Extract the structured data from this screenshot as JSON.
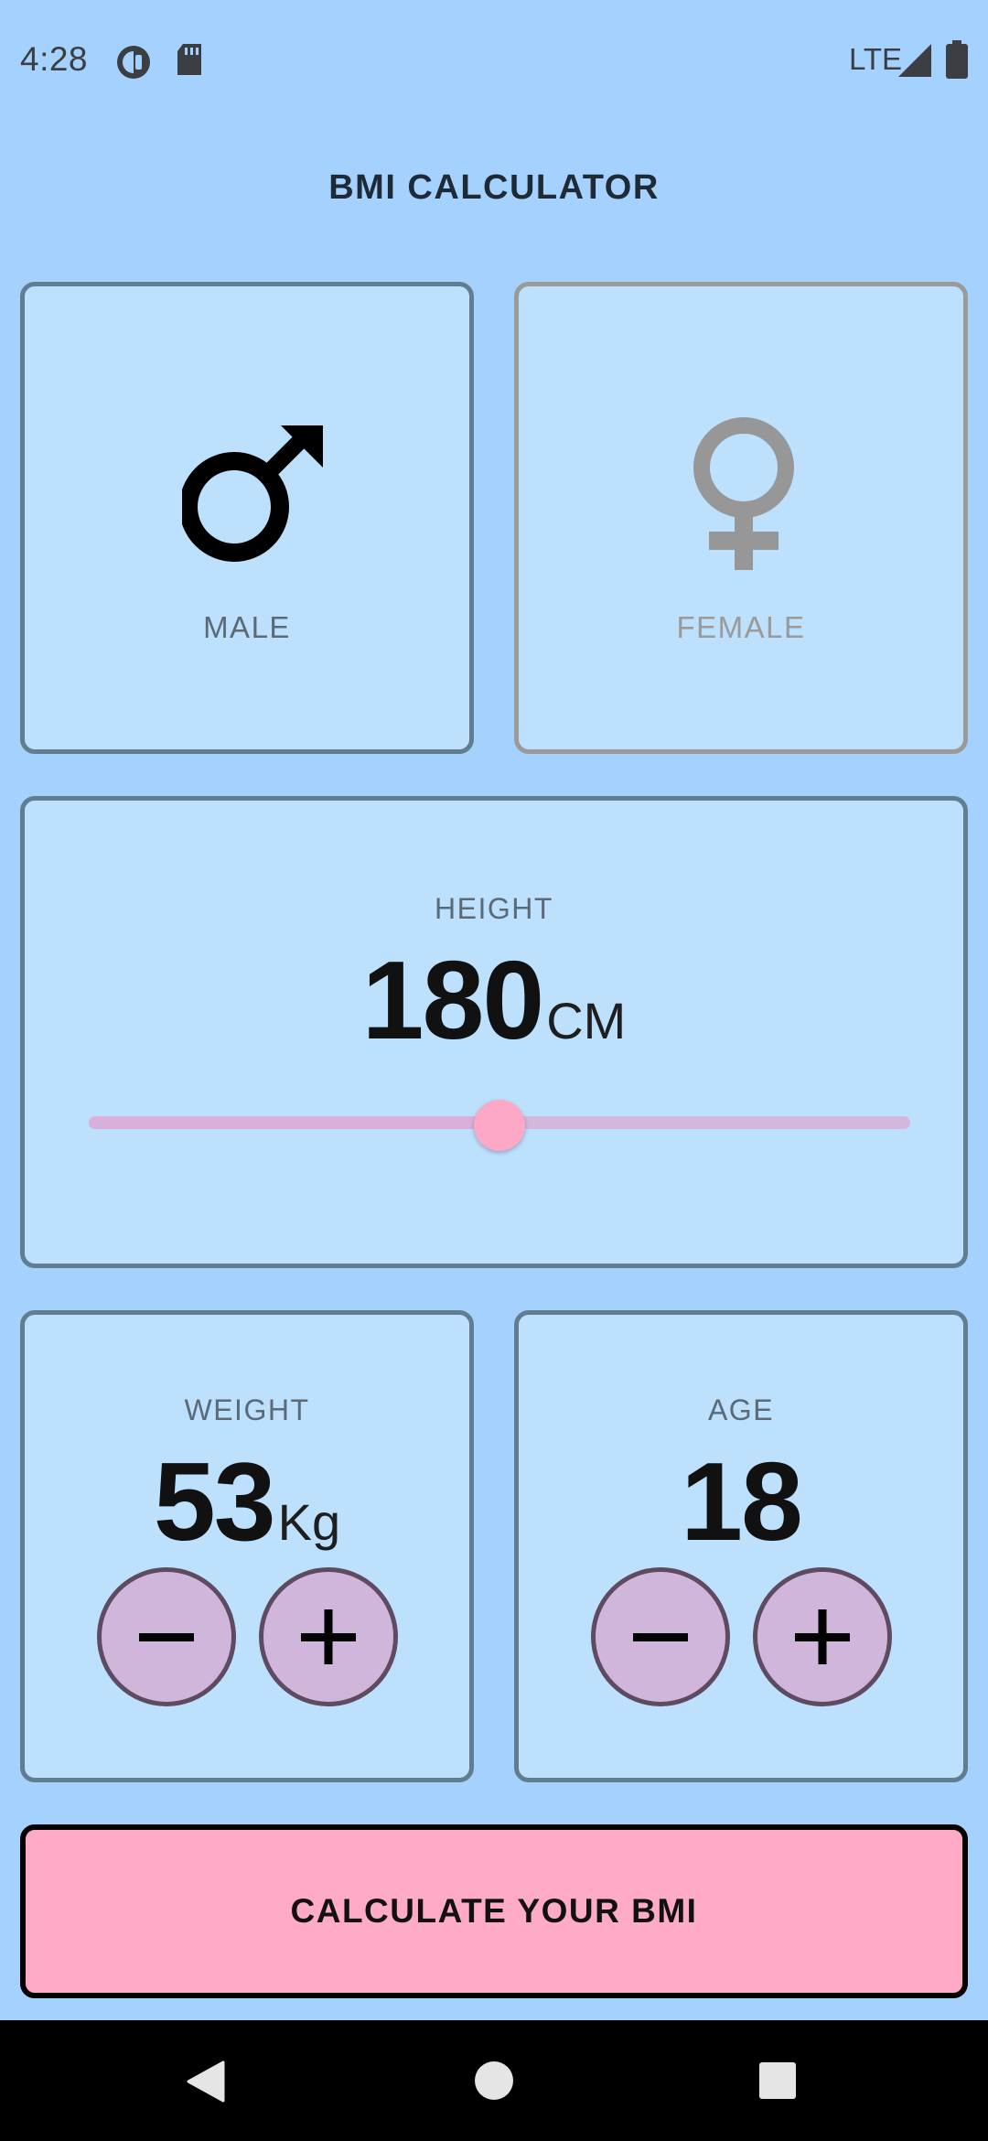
{
  "status_bar": {
    "time": "4:28",
    "network": "LTE",
    "icons": [
      "media-icon",
      "sd-card-icon",
      "signal-icon",
      "battery-icon"
    ]
  },
  "app": {
    "title": "BMI CALCULATOR"
  },
  "gender": {
    "selected": "male",
    "male": {
      "label": "MALE",
      "icon": "male-symbol-icon"
    },
    "female": {
      "label": "FEMALE",
      "icon": "female-symbol-icon"
    }
  },
  "height": {
    "label": "HEIGHT",
    "value": "180",
    "unit": "CM",
    "slider_fraction": 0.5
  },
  "weight": {
    "label": "WEIGHT",
    "value": "53",
    "unit": "Kg",
    "decrement_icon": "minus-icon",
    "increment_icon": "plus-icon"
  },
  "age": {
    "label": "AGE",
    "value": "18",
    "decrement_icon": "minus-icon",
    "increment_icon": "plus-icon"
  },
  "calculate": {
    "label": "CALCULATE YOUR BMI"
  },
  "colors": {
    "background": "#a4d1fd",
    "card": "#bde0fd",
    "card_border": "#617d92",
    "accent_pink": "#ffabc7",
    "button_lilac": "#d1b6dc"
  }
}
